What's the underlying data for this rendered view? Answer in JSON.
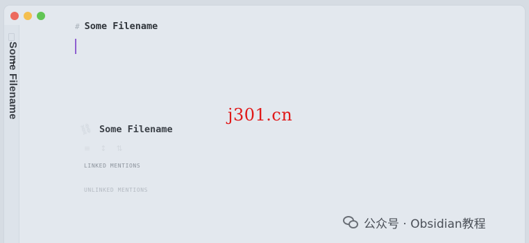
{
  "window": {
    "traffic_lights": {
      "close": "#ec6a5e",
      "minimize": "#f4bf4f",
      "maximize": "#61c554"
    }
  },
  "sidebar": {
    "vertical_title": "Some Filename"
  },
  "editor": {
    "heading_marker": "#",
    "heading_text": "Some Filename",
    "caret_color": "#8e5fd0"
  },
  "backlinks": {
    "title": "Some Filename",
    "linked_mentions_label": "LINKED MENTIONS",
    "unlinked_mentions_label": "UNLINKED MENTIONS"
  },
  "overlay": {
    "watermark": "j301.cn",
    "footer": "公众号 · Obsidian教程"
  },
  "icons": [
    "close-icon",
    "minimize-icon",
    "maximize-icon",
    "document-icon",
    "link-icon",
    "wechat-icon"
  ]
}
